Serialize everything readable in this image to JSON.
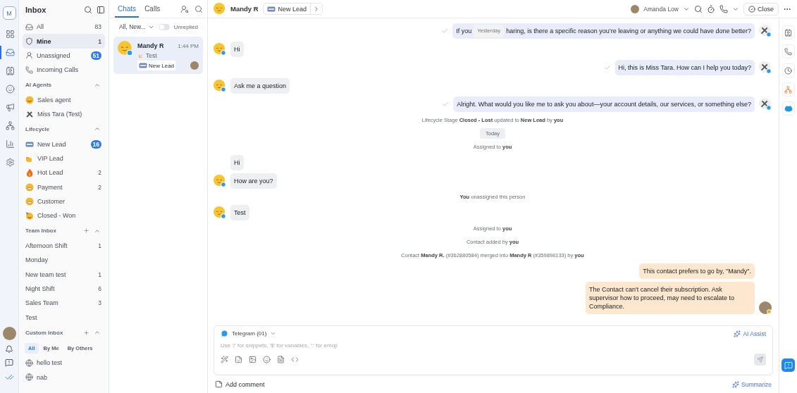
{
  "nav_rail": {
    "logo": "M",
    "items": [
      {
        "selected": false
      },
      {
        "selected": true
      },
      {
        "selected": false
      },
      {
        "selected": false
      },
      {
        "selected": false
      },
      {
        "selected": false
      },
      {
        "selected": false
      },
      {
        "selected": false
      }
    ]
  },
  "sidebar": {
    "title": "Inbox",
    "inbox_items": [
      {
        "label": "All",
        "count": "83",
        "highlight": false,
        "selected": false
      },
      {
        "label": "Mine",
        "count": "1",
        "highlight": false,
        "selected": true
      },
      {
        "label": "Unassigned",
        "count": "51",
        "highlight": true,
        "selected": false
      },
      {
        "label": "Incoming Calls",
        "selected": false
      }
    ],
    "sections": [
      {
        "title": "AI Agents",
        "add": false,
        "expanded": true,
        "items": [
          {
            "label": "Sales agent",
            "selected": false
          },
          {
            "label": "Miss Tara (Test)",
            "selected": false
          }
        ]
      },
      {
        "title": "Lifecycle",
        "add": false,
        "expanded": true,
        "items": [
          {
            "label": "New Lead",
            "count": "16",
            "highlight": true,
            "selected": false
          },
          {
            "label": "VIP Lead",
            "selected": false
          },
          {
            "label": "Hot Lead",
            "count": "2",
            "highlight": false,
            "selected": false
          },
          {
            "label": "Payment",
            "count": "2",
            "highlight": false,
            "selected": false
          },
          {
            "label": "Customer",
            "selected": false
          },
          {
            "label": "Closed - Won",
            "selected": false
          }
        ]
      },
      {
        "title": "Team Inbox",
        "add": true,
        "expanded": true,
        "items": [
          {
            "label": "Afternoon Shift",
            "count": "1",
            "highlight": false,
            "selected": false
          },
          {
            "label": "Monday",
            "selected": false
          },
          {
            "label": "New team test",
            "count": "1",
            "highlight": false,
            "selected": false
          },
          {
            "label": "Night Shift",
            "count": "6",
            "highlight": false,
            "selected": false
          },
          {
            "label": "Sales Team",
            "count": "3",
            "highlight": false,
            "selected": false
          },
          {
            "label": "Test",
            "selected": false
          }
        ]
      },
      {
        "title": "Custom Inbox",
        "add": true,
        "expanded": true,
        "filters": [
          {
            "label": "All",
            "selected": true
          },
          {
            "label": "By Me",
            "selected": false
          },
          {
            "label": "By Others",
            "selected": false
          }
        ],
        "items": [
          {
            "label": "hello test",
            "selected": false
          },
          {
            "label": "nab",
            "selected": false
          }
        ]
      }
    ]
  },
  "chat_list": {
    "tabs": [
      {
        "label": "Chats",
        "selected": true
      },
      {
        "label": "Calls",
        "selected": false
      }
    ],
    "filter": "All, New...",
    "unreplied": {
      "label": "Unreplied",
      "on": false
    },
    "chats": [
      {
        "name": "Mandy R",
        "time": "1:44 PM",
        "preview": "Test",
        "tag": "New Lead",
        "selected": true
      }
    ]
  },
  "conversation": {
    "contact": "Mandy R",
    "lifecycle": "New Lead",
    "assignee": "Amanda Low",
    "close": "Close",
    "messages": [
      {
        "kind": "outgoing",
        "text": "If you ",
        "date_pill": "Yesterday",
        "text_after": "haring, is there a specific reason you’re leaving or anything we could have done better?",
        "delivered": true
      },
      {
        "kind": "incoming",
        "text": "Hi",
        "avatar": true
      },
      {
        "kind": "outgoing",
        "text": "Hi, this is Miss Tara. How can I help you today?",
        "delivered": true
      },
      {
        "kind": "incoming",
        "text": "Ask me a question",
        "avatar": true
      },
      {
        "kind": "outgoing",
        "text": "Alright. What would you like me to ask you about—your account details, our services, or something else?",
        "delivered": true
      },
      {
        "kind": "system",
        "text": "Lifecycle Stage **Closed - Lost** updated to **New Lead** by **you**"
      },
      {
        "kind": "date",
        "text": "Today"
      },
      {
        "kind": "system",
        "text": "Assigned to **you**"
      },
      {
        "kind": "incoming",
        "text": "Hi",
        "avatar": false
      },
      {
        "kind": "incoming",
        "text": "How are you?",
        "avatar": true
      },
      {
        "kind": "system",
        "text": "**You** unassigned this person"
      },
      {
        "kind": "incoming",
        "text": "Test",
        "avatar": true
      },
      {
        "kind": "system",
        "text": "Assigned to **you**"
      },
      {
        "kind": "system",
        "text": "Contact added by **you**"
      },
      {
        "kind": "system",
        "text": "Contact **Mandy R.** (#362880584) merged into **Mandy R** (#359898133) by **you**"
      },
      {
        "kind": "note",
        "text": "This contact prefers to go by, \"Mandy\".",
        "avatar": false
      },
      {
        "kind": "note",
        "text": "The Contact can't cancel their subscription. Ask supervisor how to proceed, may need to escalate to Compliance.",
        "avatar": true
      }
    ],
    "composer": {
      "channel": "Telegram (01)",
      "ai_assist": "AI Assist",
      "placeholder": "Use '/' for snippets, '$' for variables, ':' for emoji",
      "add_comment": "Add comment",
      "summarize": "Summarize"
    }
  }
}
